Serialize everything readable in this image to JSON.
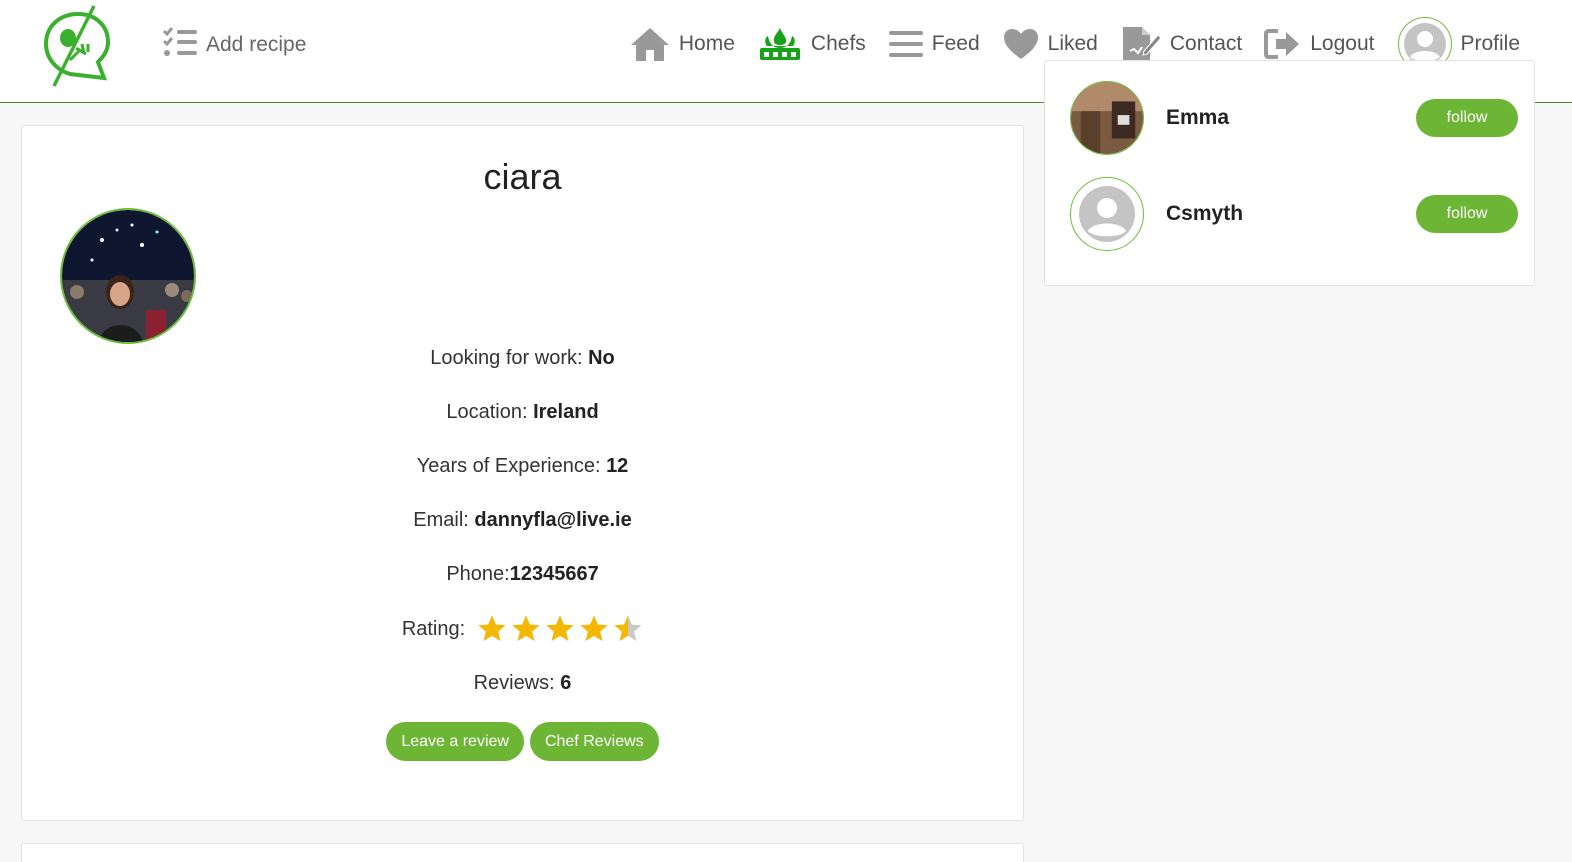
{
  "header": {
    "add_recipe_label": "Add recipe",
    "nav": {
      "home": "Home",
      "chefs": "Chefs",
      "feed": "Feed",
      "liked": "Liked",
      "contact": "Contact",
      "logout": "Logout",
      "profile": "Profile"
    },
    "icons": [
      "logo-icon",
      "checklist-icon",
      "home-icon",
      "chef-hat-icon",
      "menu-icon",
      "heart-icon",
      "edit-document-icon",
      "logout-icon",
      "user-icon"
    ]
  },
  "profile": {
    "name": "ciara",
    "looking_for_work_label": "Looking for work: ",
    "looking_for_work_value": "No",
    "location_label": "Location: ",
    "location_value": "Ireland",
    "experience_label": "Years of Experience: ",
    "experience_value": "12",
    "email_label": "Email: ",
    "email_value": "dannyfla@live.ie",
    "phone_label": "Phone:",
    "phone_value": "12345667",
    "rating_label": "Rating:",
    "rating_value": 4.5,
    "rating_max": 5,
    "reviews_label": "Reviews: ",
    "reviews_value": "6",
    "leave_review_label": "Leave a review",
    "chef_reviews_label": "Chef Reviews"
  },
  "suggested_users": [
    {
      "name": "Emma",
      "follow_label": "follow",
      "has_photo": true
    },
    {
      "name": "Csmyth",
      "follow_label": "follow",
      "has_photo": false
    }
  ],
  "colors": {
    "accent_green": "#6db534",
    "chefs_icon_green": "#17a317",
    "star_yellow": "#f5b800",
    "star_gray": "#c8c8c8",
    "nav_gray": "#555555"
  }
}
